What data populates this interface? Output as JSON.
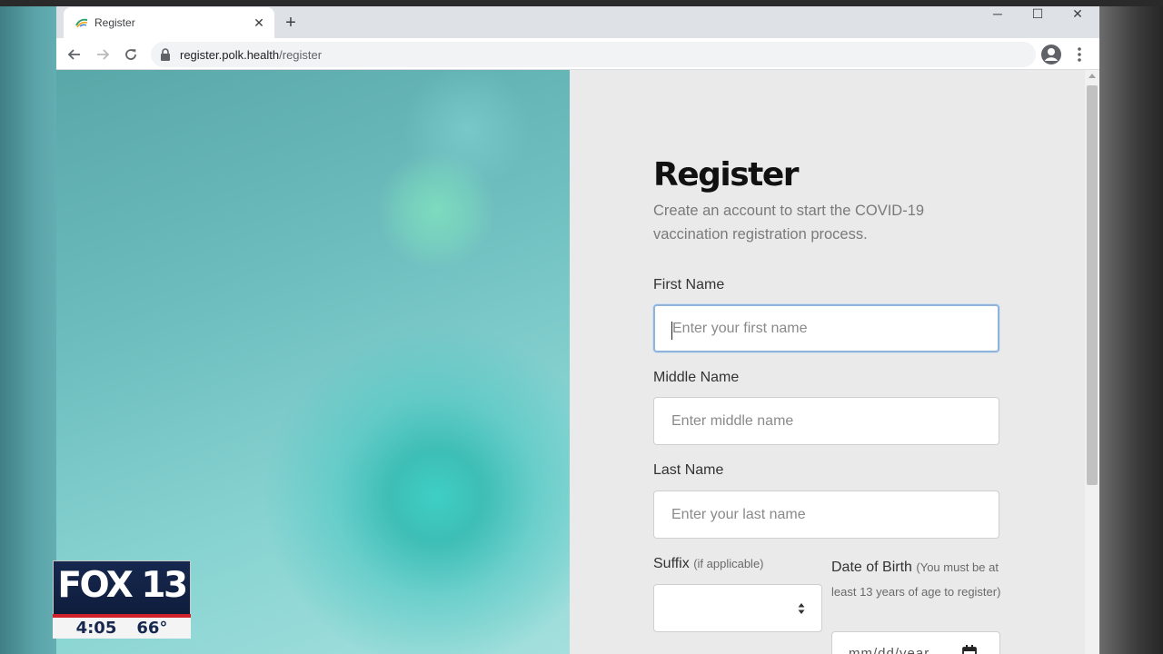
{
  "browser": {
    "tab_title": "Register",
    "url_host": "register.polk.health",
    "url_path": "/register",
    "new_tab_symbol": "+",
    "close_tab_symbol": "✕"
  },
  "window_controls": {
    "minimize": "─",
    "maximize": "☐",
    "close": "✕"
  },
  "form": {
    "title": "Register",
    "subtitle": "Create an account to start the COVID-19 vaccination registration process.",
    "first_name": {
      "label": "First Name",
      "placeholder": "Enter your first name",
      "value": ""
    },
    "middle_name": {
      "label": "Middle Name",
      "placeholder": "Enter middle name",
      "value": ""
    },
    "last_name": {
      "label": "Last Name",
      "placeholder": "Enter your last name",
      "value": ""
    },
    "suffix": {
      "label": "Suffix",
      "hint": "(if applicable)",
      "selected": ""
    },
    "dob": {
      "label": "Date of Birth",
      "hint": "(You must be at least 13 years of age to register)",
      "placeholder": "mm/dd/year"
    }
  },
  "overlay": {
    "station": "FOX 13",
    "time": "4:05",
    "temperature": "66°"
  },
  "colors": {
    "focus_border": "#8fb3d9",
    "panel_bg": "#eaeaea",
    "fox_navy": "#16284f",
    "fox_red": "#d0202a"
  },
  "icons": [
    "polk-health-favicon",
    "back-arrow-icon",
    "forward-arrow-icon",
    "reload-icon",
    "lock-icon",
    "star-icon",
    "account-icon",
    "kebab-menu-icon",
    "select-arrows-icon",
    "calendar-icon"
  ]
}
